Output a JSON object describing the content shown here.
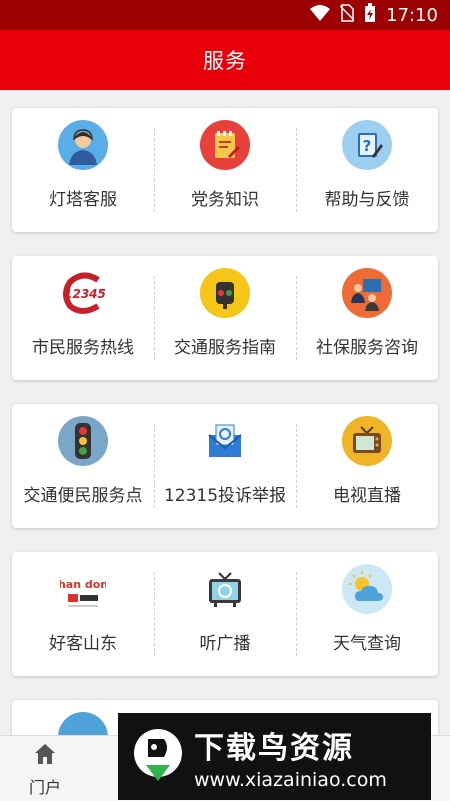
{
  "status_bar": {
    "time": "17:10"
  },
  "header": {
    "title": "服务"
  },
  "cards": [
    {
      "items": [
        {
          "label": "灯塔客服",
          "icon": "customer-service-icon",
          "bg": "#5aaee8"
        },
        {
          "label": "党务知识",
          "icon": "party-notebook-icon",
          "bg": "#e8403a"
        },
        {
          "label": "帮助与反馈",
          "icon": "help-feedback-icon",
          "bg": "#9dd0f0"
        }
      ]
    },
    {
      "items": [
        {
          "label": "市民服务热线",
          "icon": "hotline-12345-icon",
          "bg": "#ffffff",
          "badge": "12345"
        },
        {
          "label": "交通服务指南",
          "icon": "traffic-light-icon",
          "bg": "#f5c518"
        },
        {
          "label": "社保服务咨询",
          "icon": "social-security-icon",
          "bg": "#f06a35"
        }
      ]
    },
    {
      "items": [
        {
          "label": "交通便民服务点",
          "icon": "traffic-signal-icon",
          "bg": "#7aa6c8"
        },
        {
          "label": "12315投诉举报",
          "icon": "complaint-mail-icon",
          "bg": "#ffffff"
        },
        {
          "label": "电视直播",
          "icon": "tv-live-icon",
          "bg": "#f0b429"
        }
      ]
    },
    {
      "items": [
        {
          "label": "好客山东",
          "icon": "haoke-shandong-logo",
          "bg": "#ffffff",
          "logo_text": "Shan dong"
        },
        {
          "label": "听广播",
          "icon": "radio-icon",
          "bg": "#ffffff"
        },
        {
          "label": "天气查询",
          "icon": "weather-icon",
          "bg": "#cde8f5"
        }
      ]
    }
  ],
  "bottom_nav": {
    "items": [
      {
        "label": "门户",
        "icon": "home-icon"
      }
    ]
  },
  "watermark": {
    "title": "下载鸟资源",
    "url": "www.xiazainiao.com"
  },
  "colors": {
    "header": "#e8000b",
    "status_bar": "#9c0000"
  }
}
